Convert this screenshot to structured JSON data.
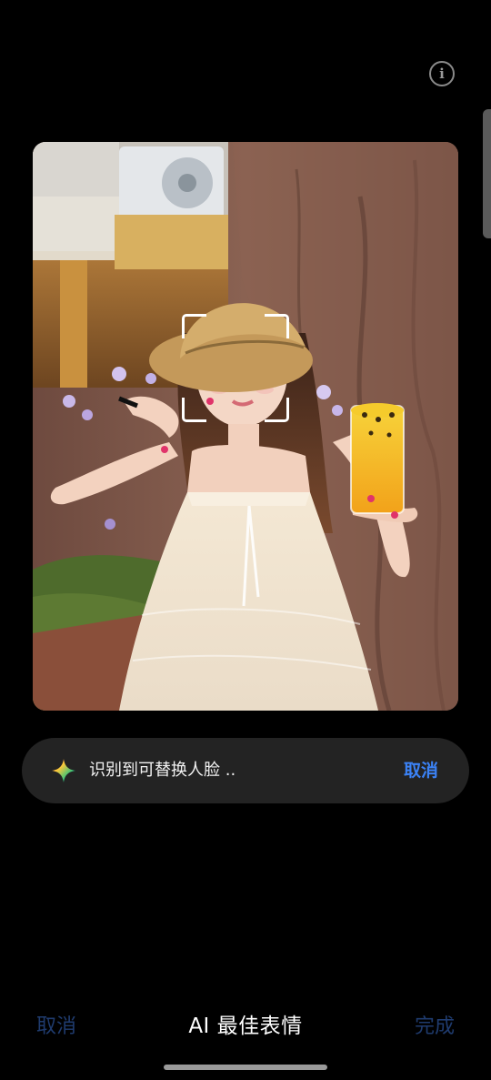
{
  "header": {
    "info_icon": "info-icon",
    "info_glyph": "i"
  },
  "photo": {
    "subject": "portrait-photo",
    "face_frame": "face-detection-frame"
  },
  "status_pill": {
    "icon": "sparkle-icon",
    "text": "识别到可替换人脸 ..",
    "cancel_label": "取消",
    "accent_color": "#3b82f6"
  },
  "bottom_bar": {
    "cancel_label": "取消",
    "title": "AI 最佳表情",
    "done_label": "完成",
    "disabled_color": "#1f3b6e"
  }
}
